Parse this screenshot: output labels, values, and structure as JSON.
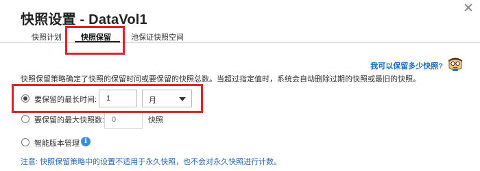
{
  "dialog": {
    "title": "快照设置 - DataVol1"
  },
  "tabs": [
    {
      "label": "快照计划",
      "active": false
    },
    {
      "label": "快照保留",
      "active": true
    },
    {
      "label": "池保证快照空间",
      "active": false
    }
  ],
  "help": {
    "link_text": "我可以保留多少快照?",
    "avatar_icon": "help-assistant-icon"
  },
  "retention": {
    "description": "快照保留策略确定了快照的保留时间或要保留的快照总数。当超过指定值时，系统会自动删除过期的快照或最旧的快照。",
    "options": [
      {
        "label": "要保留的最长时间:",
        "checked": true
      },
      {
        "label": "要保留的最大快照数:",
        "checked": false
      },
      {
        "label": "智能版本管理",
        "checked": false
      }
    ],
    "max_time": {
      "value": "1",
      "unit": "月"
    },
    "max_count": {
      "placeholder": "0",
      "unit": "快照"
    },
    "note": "注意: 快照保留策略中的设置不适用于永久快照，也不会对永久快照进行计数。"
  },
  "colors": {
    "highlight": "#e0202a",
    "link": "#1a6fc4",
    "info": "#3b8fd9"
  }
}
